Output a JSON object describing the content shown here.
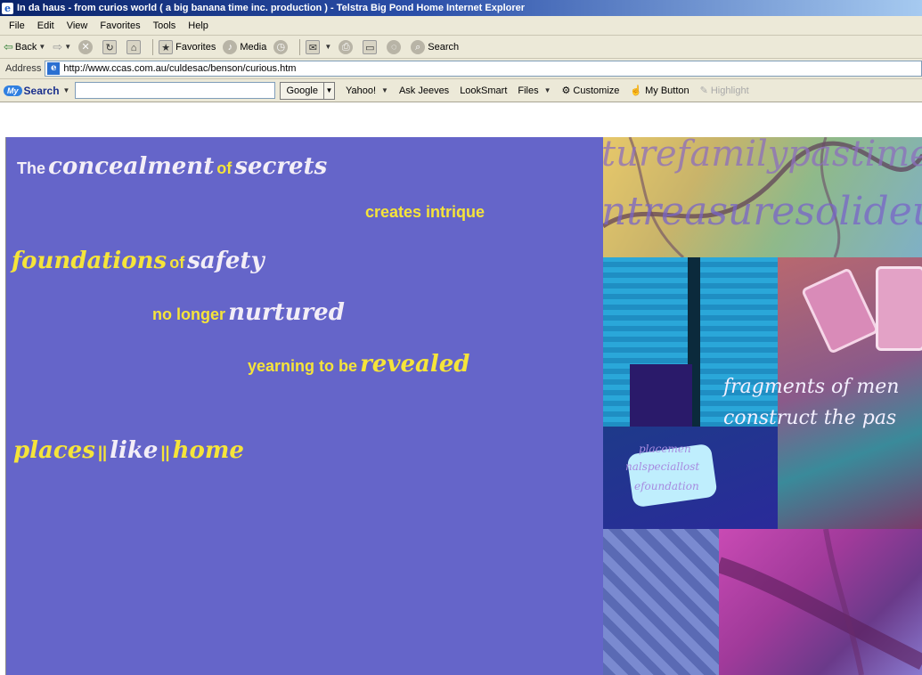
{
  "window": {
    "title": "In da haus - from curios world ( a big banana time inc. production ) - Telstra Big Pond Home Internet Explorer",
    "icon": "ie-icon"
  },
  "menubar": {
    "items": [
      "File",
      "Edit",
      "View",
      "Favorites",
      "Tools",
      "Help"
    ]
  },
  "toolbar": {
    "back_label": "Back",
    "favorites_label": "Favorites",
    "media_label": "Media",
    "search_label": "Search"
  },
  "addressbar": {
    "label": "Address",
    "url": "http://www.ccas.com.au/culdesac/benson/curious.htm"
  },
  "searchbar": {
    "logo_my": "My",
    "logo_text": "Search",
    "engine_label": "Google",
    "links": [
      "Yahoo!",
      "Ask Jeeves",
      "LookSmart",
      "Files",
      "Customize",
      "My Button",
      "Highlight"
    ]
  },
  "page": {
    "background_color": "#6565c9",
    "text_yellow": "#f5e43a",
    "text_white": "#f3eef7",
    "line1": {
      "a": "The",
      "b": "concealment",
      "c": "of",
      "d": "secrets"
    },
    "line2": {
      "a": "creates intrique"
    },
    "line3": {
      "a": "foundations",
      "b": "of",
      "c": "safety"
    },
    "line4": {
      "a": "no longer",
      "b": "nurtured"
    },
    "line5": {
      "a": "yearning to be",
      "b": "revealed"
    },
    "line6": {
      "a": "places",
      "sep1": "||",
      "b": "like",
      "sep2": "||",
      "c": "home"
    },
    "collage": {
      "word_row1": "turefamilypastime",
      "word_row2": "ntreasuresolideur",
      "fragment_line1": "fragments of men",
      "fragment_line2": "construct the pas",
      "small1": "placemen",
      "small2": "nalspeciallost",
      "small3": "efoundation"
    }
  }
}
